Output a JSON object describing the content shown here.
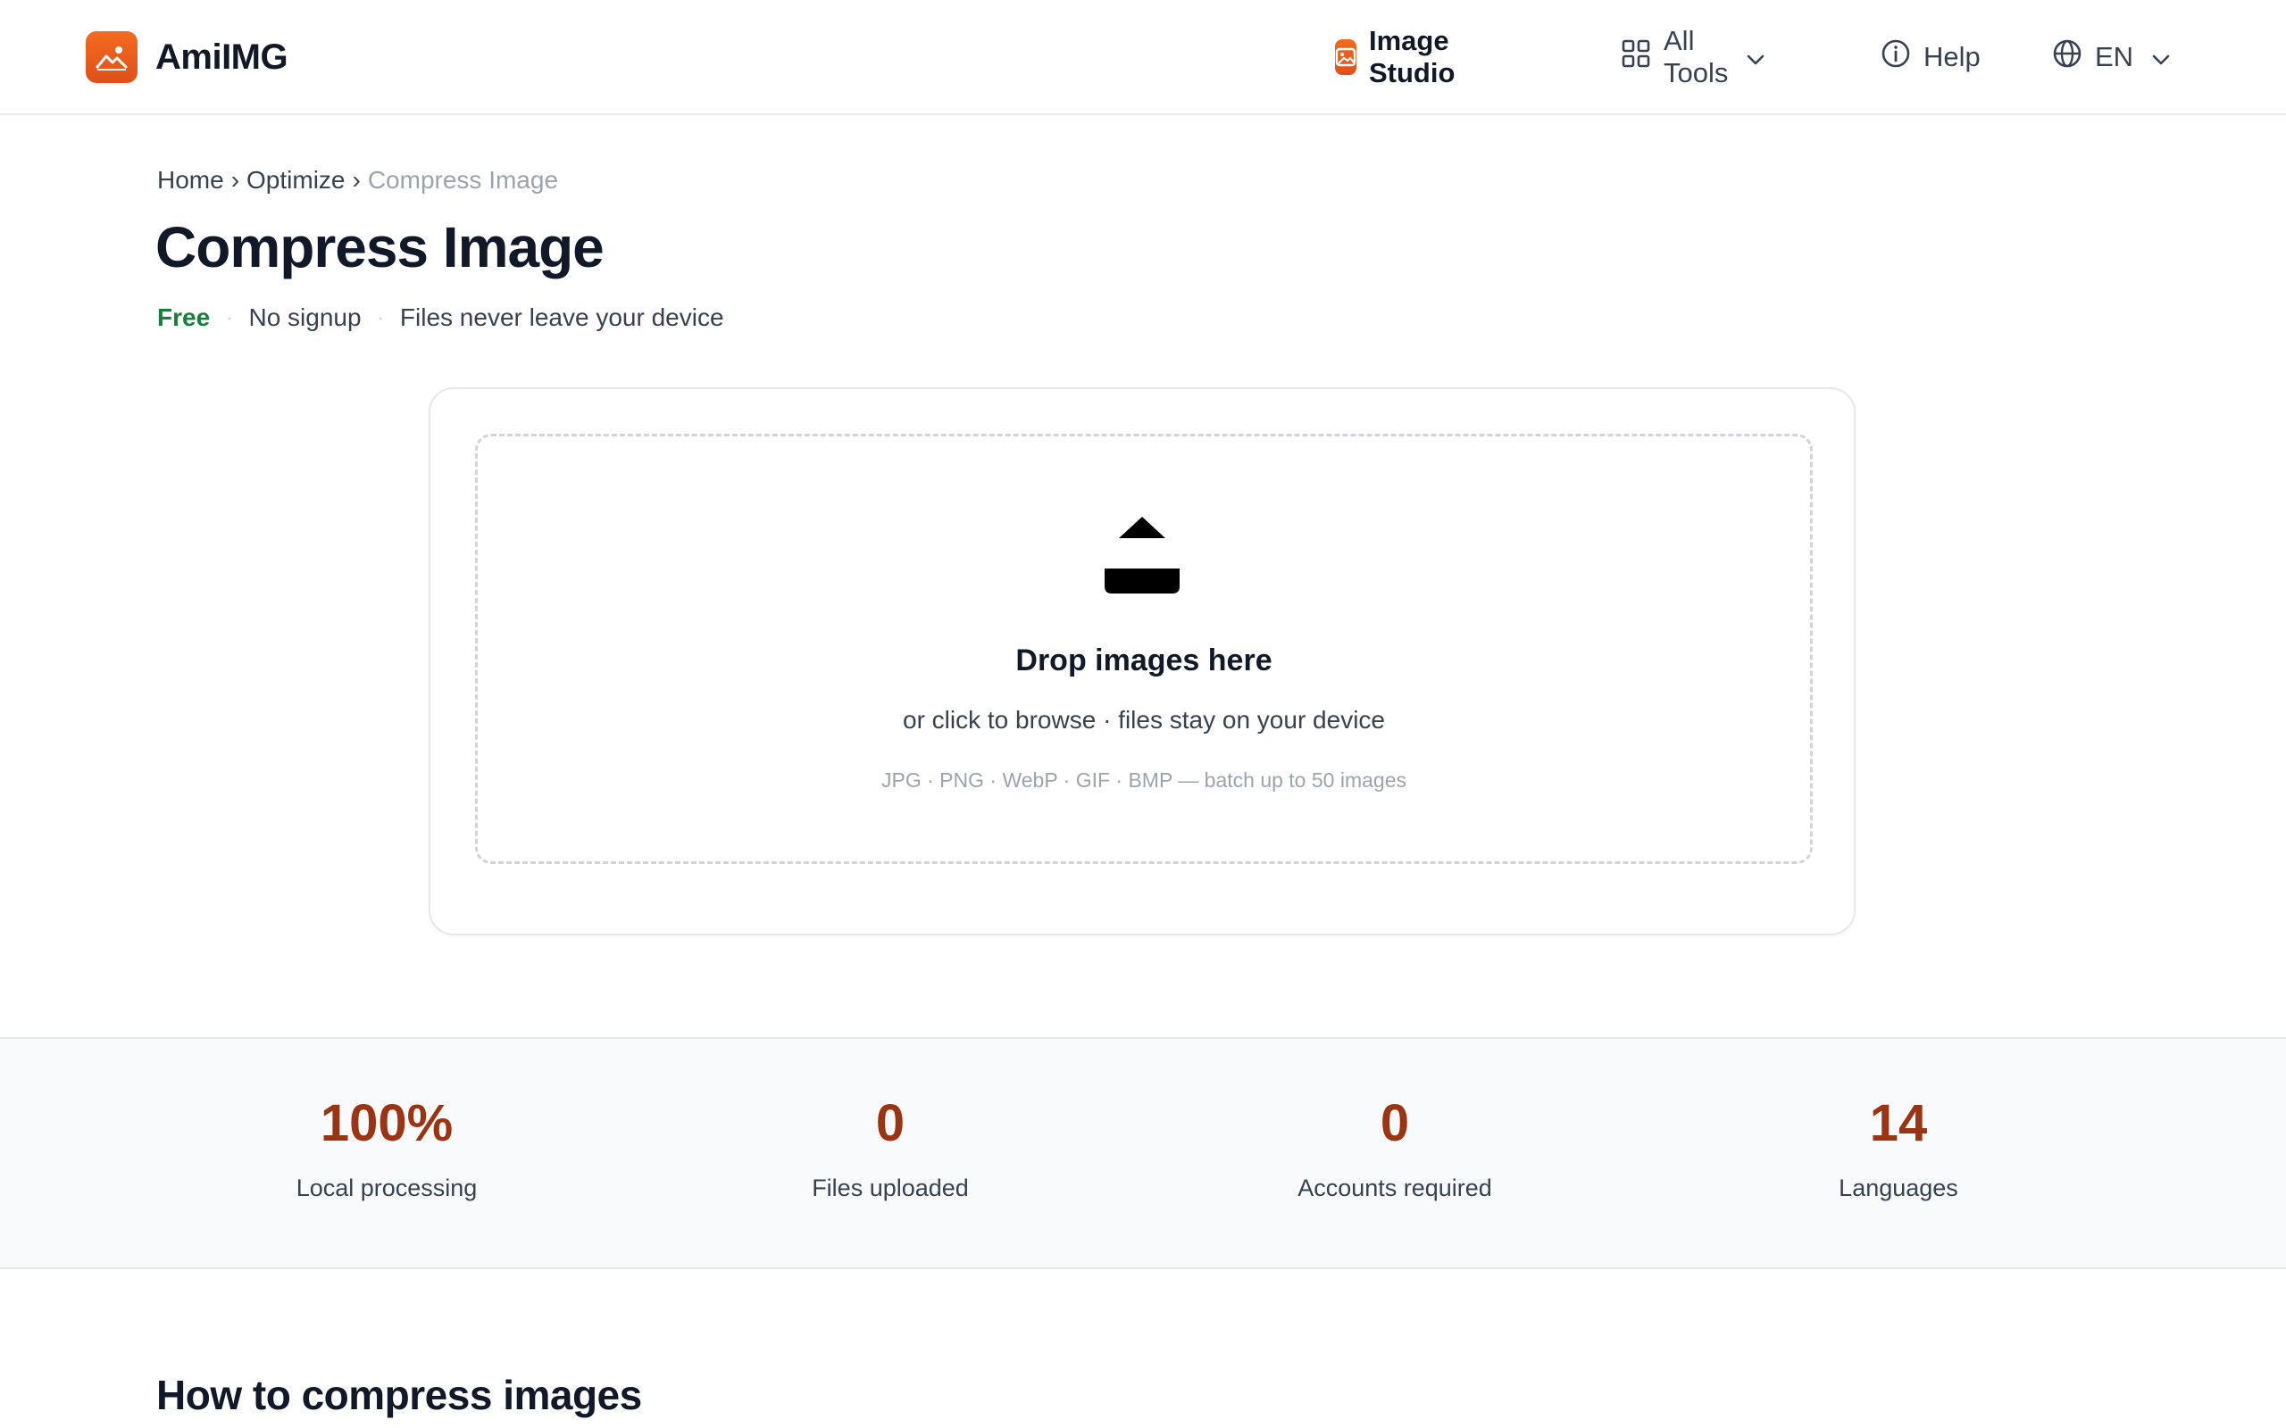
{
  "header": {
    "brand": "AmiIMG",
    "nav": {
      "studio": "Image Studio",
      "tools": "All Tools",
      "help": "Help",
      "lang": "EN"
    }
  },
  "breadcrumb": {
    "home": "Home",
    "sep": "›",
    "section": "Optimize",
    "current": "Compress Image"
  },
  "page": {
    "title": "Compress Image",
    "tags": {
      "free": "Free",
      "signup": "No signup",
      "privacy": "Files never leave your device",
      "dot": "·"
    }
  },
  "dropzone": {
    "title": "Drop images here",
    "subtitle": "or click to browse · files stay on your device",
    "formats": "JPG · PNG · WebP · GIF · BMP — batch up to 50 images"
  },
  "stats": [
    {
      "value": "100%",
      "label": "Local processing"
    },
    {
      "value": "0",
      "label": "Files uploaded"
    },
    {
      "value": "0",
      "label": "Accounts required"
    },
    {
      "value": "14",
      "label": "Languages"
    }
  ],
  "howto": {
    "title": "How to compress images"
  },
  "colors": {
    "brand": "#e85d1c",
    "stat": "#9a3412",
    "free": "#15803d"
  }
}
